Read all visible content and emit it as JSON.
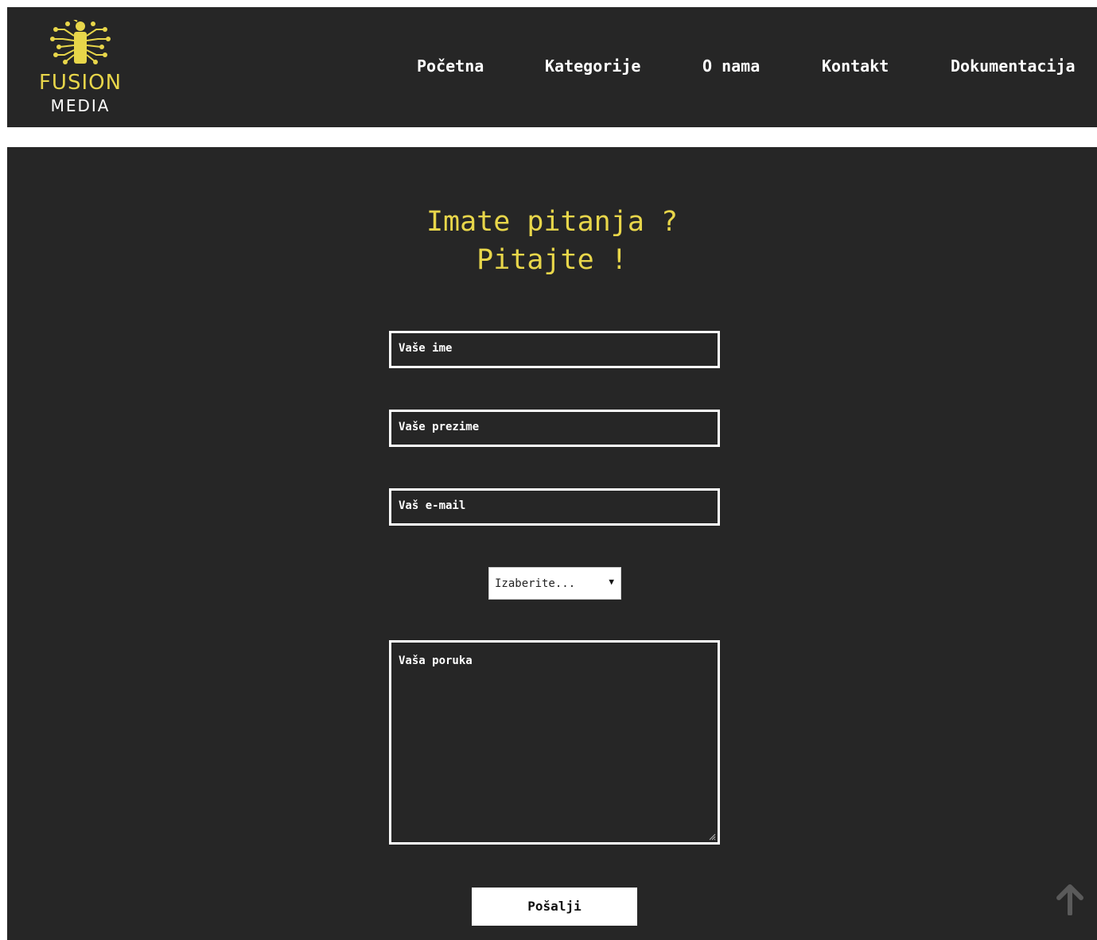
{
  "brand": {
    "logo_text_top": "FUSION",
    "logo_text_bottom": "MEDIA",
    "accent_color": "#e8d64a",
    "background_color": "#262626"
  },
  "nav": {
    "items": [
      {
        "label": "Početna"
      },
      {
        "label": "Kategorije"
      },
      {
        "label": "O nama"
      },
      {
        "label": "Kontakt"
      },
      {
        "label": "Dokumentacija"
      }
    ]
  },
  "contact_form": {
    "heading_line1": "Imate pitanja ?",
    "heading_line2": "Pitajte !",
    "first_name_placeholder": "Vaše ime",
    "last_name_placeholder": "Vaše prezime",
    "email_placeholder": "Vaš e-mail",
    "select_value": "Izaberite...",
    "message_placeholder": "Vaša poruka",
    "submit_label": "Pošalji"
  },
  "icons": {
    "logo": "circuit-person-icon",
    "dropdown": "caret-down-icon",
    "back_to_top": "arrow-up-icon"
  }
}
